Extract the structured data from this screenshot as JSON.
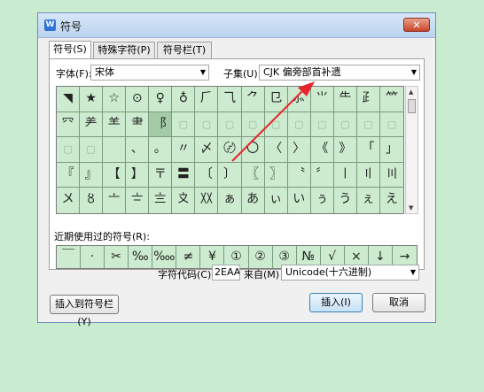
{
  "dialog": {
    "title": "符号",
    "app_icon_text": "W",
    "close_symbol": "✕"
  },
  "tabs": [
    "符号(S)",
    "特殊字符(P)",
    "符号栏(T)"
  ],
  "font": {
    "label": "字体(F):",
    "value": "宋体"
  },
  "subset": {
    "label": "子集(U):",
    "value": "CJK 偏旁部首补遗"
  },
  "symbols": [
    [
      "◥",
      "★",
      "☆",
      "⊙",
      "♀",
      "♁",
      "⺁",
      "⺄",
      "⺈",
      "⺋",
      "⺗",
      "⺌",
      "⺧",
      "⺪",
      "⺮"
    ],
    [
      "⺳",
      "⺶",
      "⺷",
      "⺻",
      "⻏",
      "▢",
      "▢",
      "▢",
      "▢",
      "▢",
      "▢",
      "▢",
      "▢",
      "▢",
      "▢"
    ],
    [
      "▢",
      "▢",
      "",
      "、",
      "。",
      "〃",
      "〆",
      "〄",
      "〇",
      "〈",
      "〉",
      "《",
      "》",
      "「",
      "」"
    ],
    [
      "『",
      "』",
      "【",
      "】",
      "〒",
      "〓",
      "〔",
      "〕",
      "〖",
      "〗",
      "〝",
      "〞",
      "〡",
      "〢",
      "〣"
    ],
    [
      "〤",
      "〥",
      "〦",
      "〧",
      "〨",
      "〩",
      "〷",
      "ぁ",
      "あ",
      "ぃ",
      "い",
      "ぅ",
      "う",
      "ぇ",
      "え"
    ]
  ],
  "selected_symbol": "⻏",
  "recent": {
    "label": "近期使用过的符号(R):",
    "items": [
      "￣",
      "·",
      "✂",
      "‰",
      "‱",
      "≠",
      "¥",
      "①",
      "②",
      "③",
      "№",
      "√",
      "×",
      "↓",
      "→"
    ]
  },
  "char_code": {
    "label": "字符代码(C):",
    "value": "2EAA"
  },
  "from": {
    "label": "来自(M)",
    "value": "Unicode(十六进制)"
  },
  "buttons": {
    "insert_to_bar": "插入到符号栏(Y)",
    "insert": "插入(I)",
    "cancel": "取消"
  },
  "colors": {
    "page_bg": "#c9ecd0",
    "grid_bg": "#ccebcf",
    "selected_bg": "#a3cba8",
    "arrow": "#e8252d"
  },
  "icons": {
    "close": "close-icon",
    "dropdown": "chevron-down-icon",
    "annotation": "red-arrow-icon"
  }
}
